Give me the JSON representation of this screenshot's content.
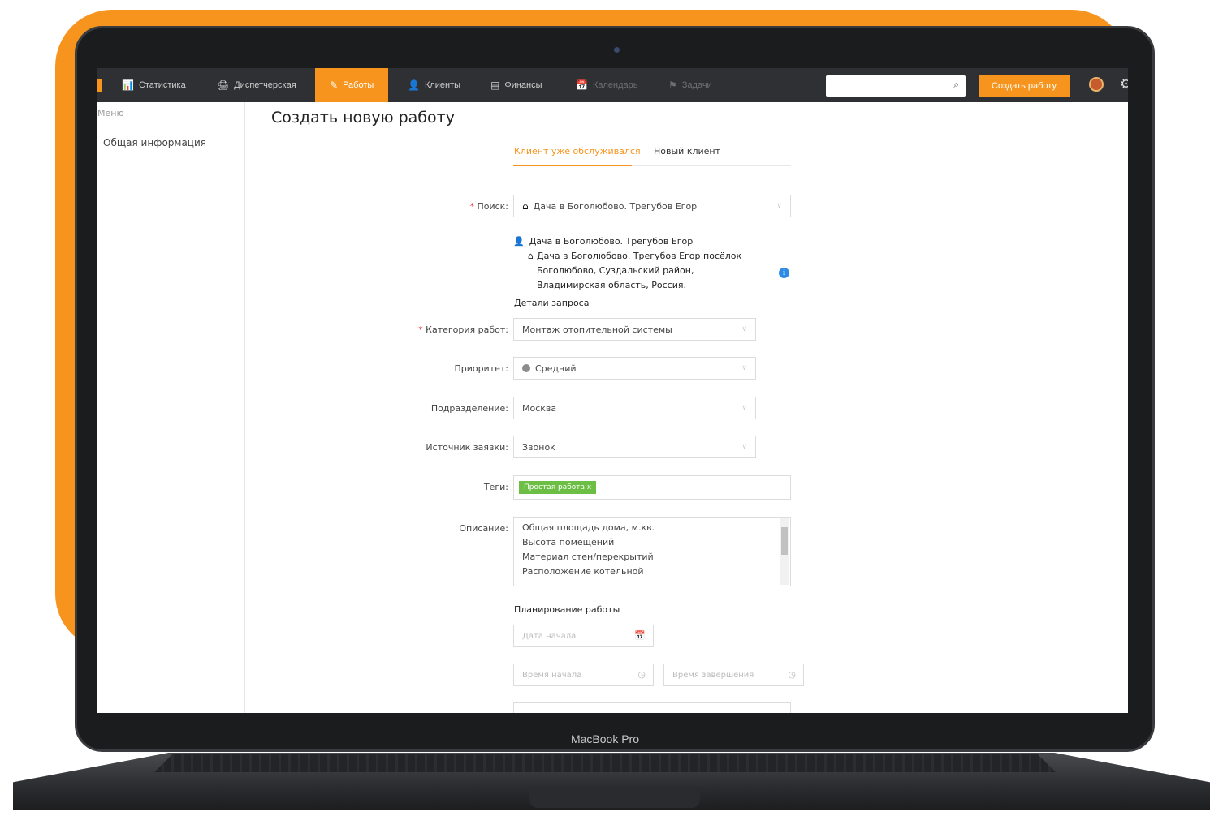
{
  "device": {
    "label": "MacBook Pro"
  },
  "nav": {
    "items": [
      {
        "icon": "📊",
        "label": "Статистика"
      },
      {
        "icon": "🖨",
        "label": "Диспетчерская"
      },
      {
        "icon": "✎",
        "label": "Работы"
      },
      {
        "icon": "👤",
        "label": "Клиенты"
      },
      {
        "icon": "▤",
        "label": "Финансы"
      },
      {
        "icon": "📅",
        "label": "Календарь"
      },
      {
        "icon": "⚑",
        "label": "Задачи"
      }
    ],
    "search_placeholder": "",
    "search_icon": "⌕",
    "create_label": "Создать работу",
    "gear_icon": "⚙"
  },
  "sidebar": {
    "header": "Меню",
    "items": [
      "Общая информация"
    ]
  },
  "page": {
    "title": "Создать новую работу",
    "tabs": [
      "Клиент уже обслуживался",
      "Новый клиент"
    ]
  },
  "form": {
    "search": {
      "required": "*",
      "label": "Поиск:",
      "value": "Дача в Боголюбово. Трегубов Егор"
    },
    "client": {
      "person_icon": "👤",
      "home_icon": "⌂",
      "name": "Дача в Боголюбово. Трегубов Егор",
      "address": "Дача в Боголюбово. Трегубов Егор посёлок Боголюбово, Суздальский район, Владимирская область, Россия.",
      "info_icon": "i"
    },
    "details_header": "Детали запроса",
    "category": {
      "required": "*",
      "label": "Категория работ:",
      "value": "Монтаж отопительной системы"
    },
    "priority": {
      "label": "Приоритет:",
      "value": "Средний"
    },
    "department": {
      "label": "Подразделение:",
      "value": "Москва"
    },
    "source": {
      "label": "Источник заявки:",
      "value": "Звонок"
    },
    "tags": {
      "label": "Теги:",
      "items": [
        "Простая работа x"
      ]
    },
    "description": {
      "label": "Описание:",
      "lines": [
        "Общая площадь дома, м.кв.",
        "Высота помещений",
        "Материал стен/перекрытий",
        "Расположение котельной"
      ]
    },
    "planning": {
      "header": "Планирование работы",
      "start_date_placeholder": "Дата начала",
      "start_time_placeholder": "Время начала",
      "end_time_placeholder": "Время завершения",
      "calendar_icon": "📅",
      "clock_icon": "◷"
    },
    "chevron": "∨"
  },
  "colors": {
    "accent": "#f7941d",
    "tag": "#6cbf44",
    "info": "#2b8be6",
    "required": "#e8484e",
    "topbar": "#2f3033"
  }
}
